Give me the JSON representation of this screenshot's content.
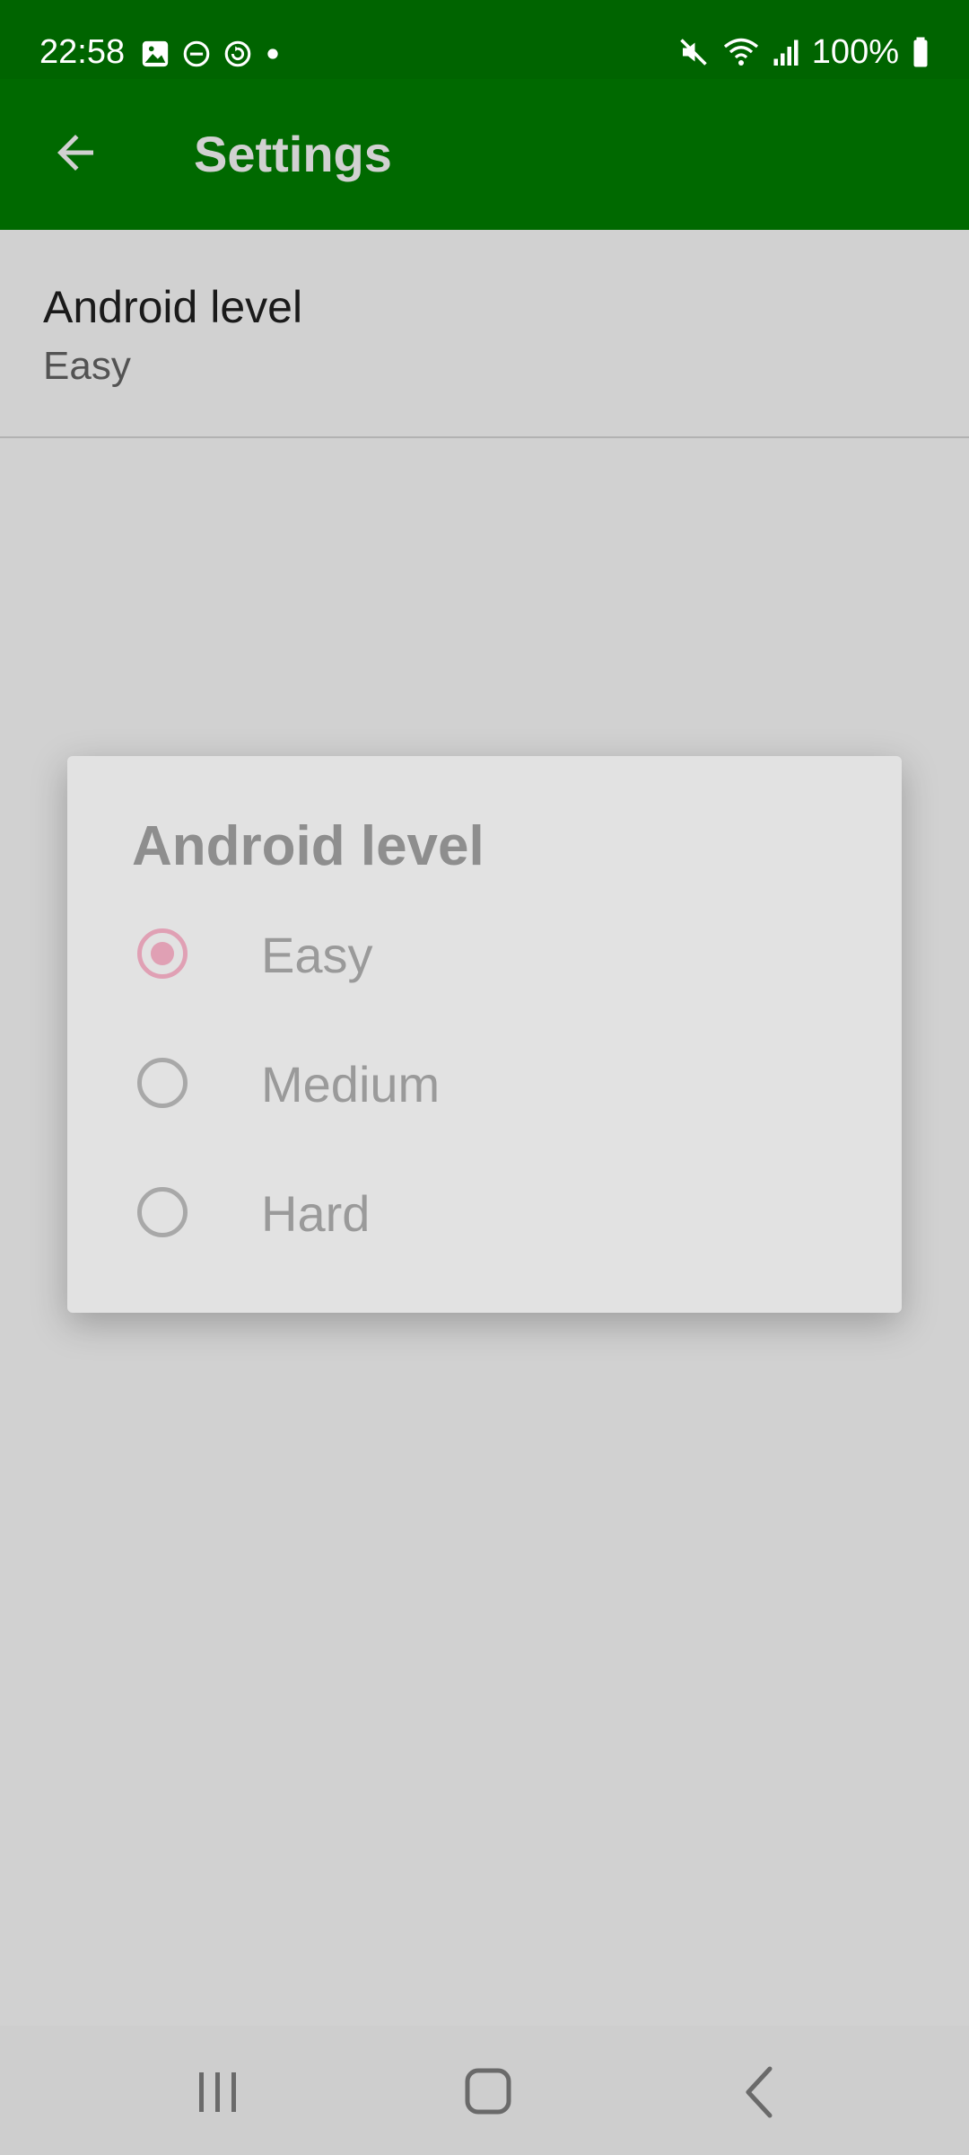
{
  "status_bar": {
    "time": "22:58",
    "battery": "100%",
    "icons_left": [
      "image-icon",
      "dnd-icon",
      "sync-icon",
      "dot-icon"
    ],
    "icons_right": [
      "mute-icon",
      "wifi-icon",
      "signal-icon",
      "battery-icon"
    ]
  },
  "app_bar": {
    "title": "Settings",
    "back_icon": "back-arrow-icon",
    "color": "#008000"
  },
  "preference": {
    "title": "Android level",
    "summary": "Easy"
  },
  "dialog": {
    "title": "Android level",
    "options": [
      {
        "label": "Easy",
        "selected": true
      },
      {
        "label": "Medium",
        "selected": false
      },
      {
        "label": "Hard",
        "selected": false
      }
    ],
    "accent": "#e0a0b4"
  },
  "nav_bar": {
    "buttons": [
      "recent-apps-icon",
      "home-icon",
      "back-icon"
    ]
  }
}
